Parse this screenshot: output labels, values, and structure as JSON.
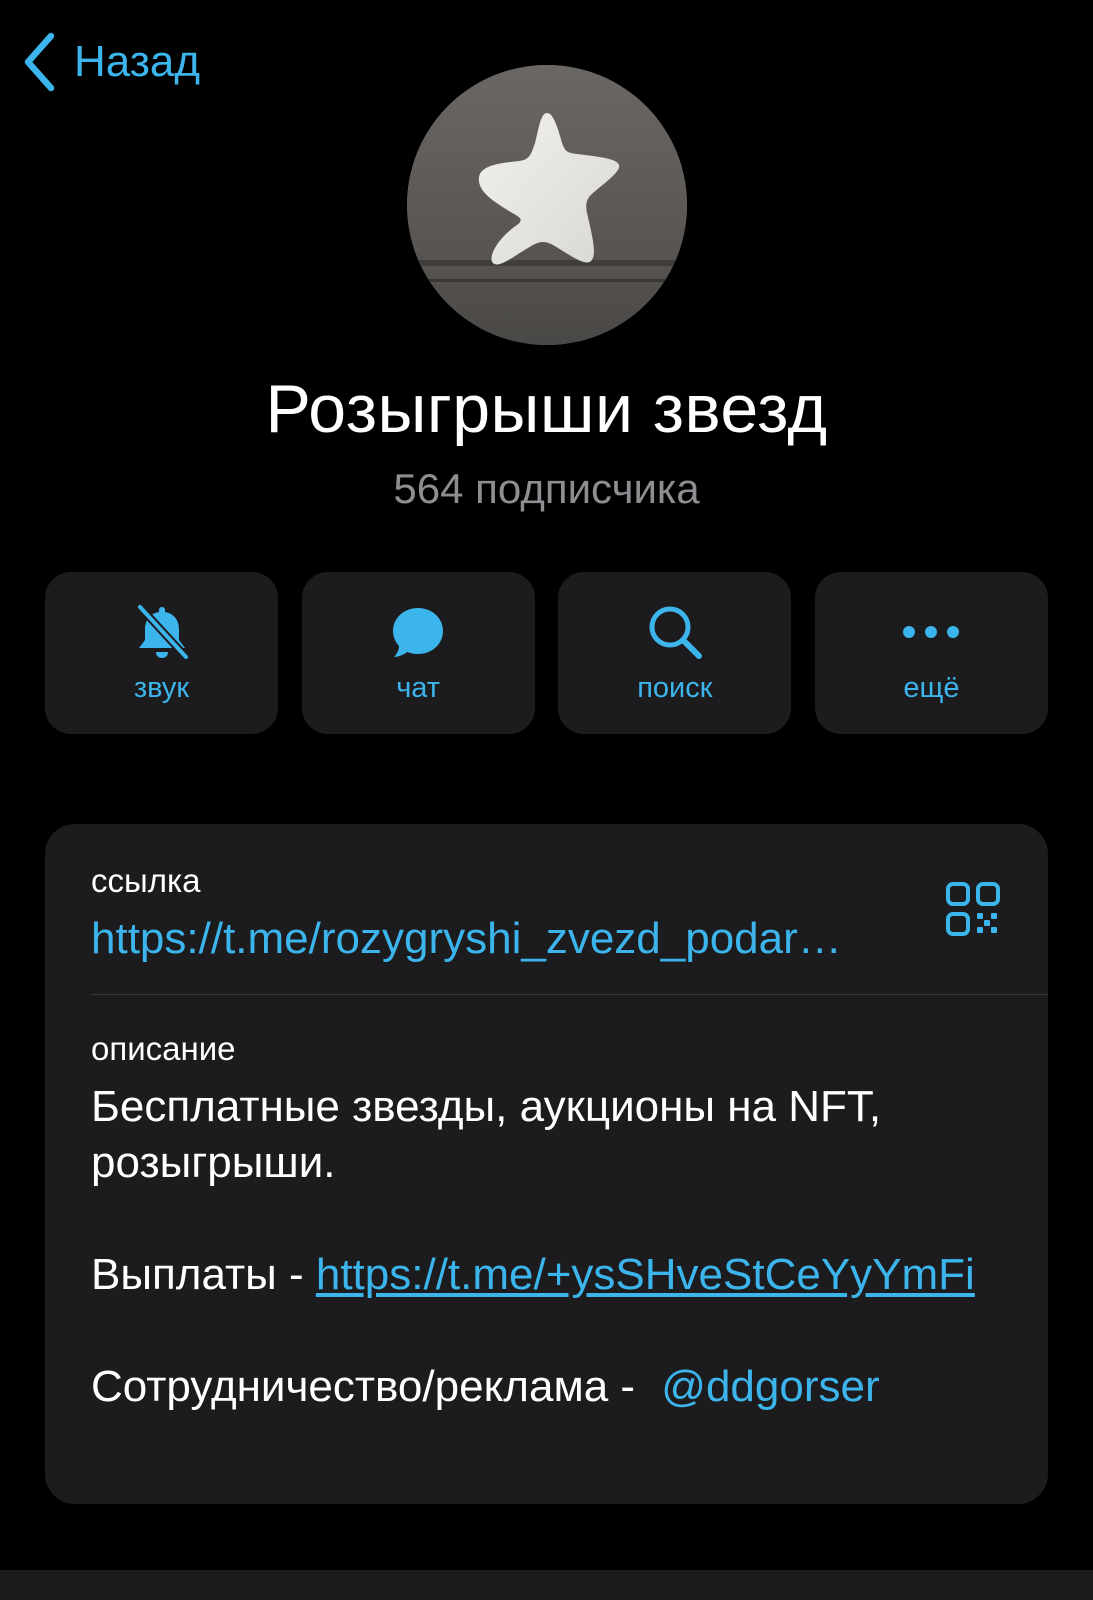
{
  "nav": {
    "back_label": "Назад",
    "back_icon": "chevron-left-icon"
  },
  "channel": {
    "title": "Розыгрыши звезд",
    "subscribers": "564 подписчика"
  },
  "actions": [
    {
      "label": "звук",
      "icon": "bell-slash-icon"
    },
    {
      "label": "чат",
      "icon": "chat-bubble-icon"
    },
    {
      "label": "поиск",
      "icon": "search-icon"
    },
    {
      "label": "ещё",
      "icon": "more-icon"
    }
  ],
  "info": {
    "link_label": "ссылка",
    "link_value": "https://t.me/rozygryshi_zvezd_podar…",
    "description_label": "описание",
    "description_line1": "Бесплатные звезды, аукционы на NFT, розыгрыши.",
    "payouts_prefix": "Выплаты - ",
    "payouts_link": "https://t.me/+ysSHveStCeYyYmFi",
    "cooperation_prefix": "Сотрудничество/реклама - ",
    "cooperation_mention": "@ddgorser"
  },
  "colors": {
    "background": "#000000",
    "card": "#1c1c1e",
    "accent": "#3cb4ec",
    "secondary_text": "#8d8d92"
  }
}
